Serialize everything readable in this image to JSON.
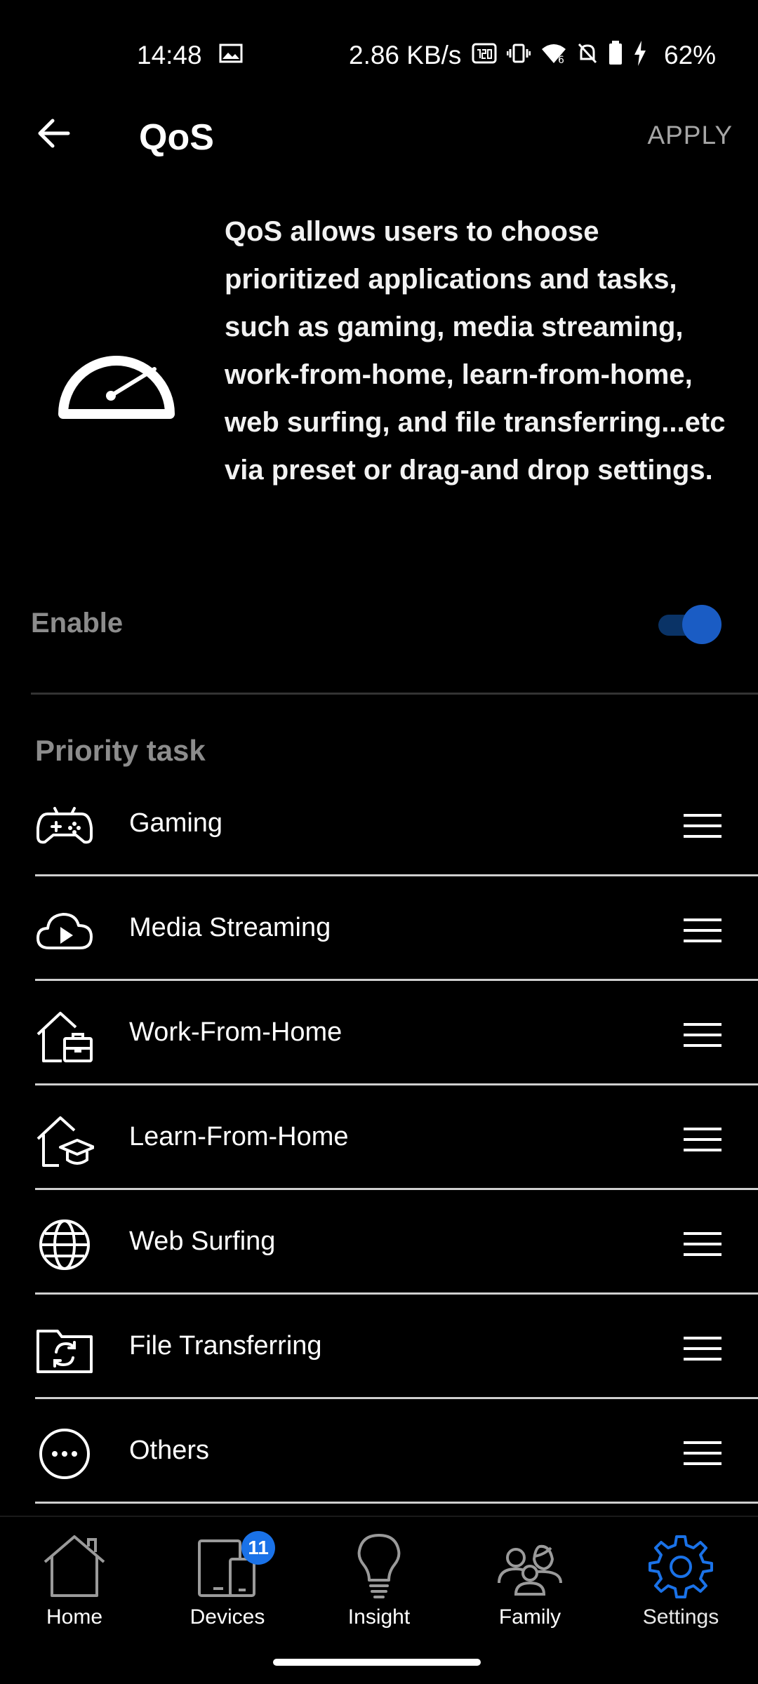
{
  "status_bar": {
    "time": "14:48",
    "speed": "2.86 KB/s",
    "battery": "62%"
  },
  "app_bar": {
    "title": "QoS",
    "apply_label": "APPLY"
  },
  "intro": {
    "description": "QoS allows users to choose prioritized applications and tasks, such as gaming, media streaming, work-from-home, learn-from-home, web surfing, and file transferring...etc via preset or drag-and drop settings."
  },
  "enable": {
    "label": "Enable",
    "on": true,
    "accent": "#1a5cc4"
  },
  "priority": {
    "title": "Priority task",
    "tasks": [
      {
        "label": "Gaming",
        "icon": "gamepad-icon"
      },
      {
        "label": "Media Streaming",
        "icon": "cloud-play-icon"
      },
      {
        "label": "Work-From-Home",
        "icon": "home-briefcase-icon"
      },
      {
        "label": "Learn-From-Home",
        "icon": "home-graduation-icon"
      },
      {
        "label": "Web Surfing",
        "icon": "globe-icon"
      },
      {
        "label": "File Transferring",
        "icon": "folder-sync-icon"
      },
      {
        "label": "Others",
        "icon": "more-circle-icon"
      }
    ]
  },
  "bottom_nav": {
    "items": [
      {
        "label": "Home",
        "icon": "home-icon"
      },
      {
        "label": "Devices",
        "icon": "devices-icon",
        "badge": "11"
      },
      {
        "label": "Insight",
        "icon": "lightbulb-icon"
      },
      {
        "label": "Family",
        "icon": "family-icon"
      },
      {
        "label": "Settings",
        "icon": "gear-icon",
        "active": true
      }
    ],
    "active_color": "#1a72e8"
  }
}
